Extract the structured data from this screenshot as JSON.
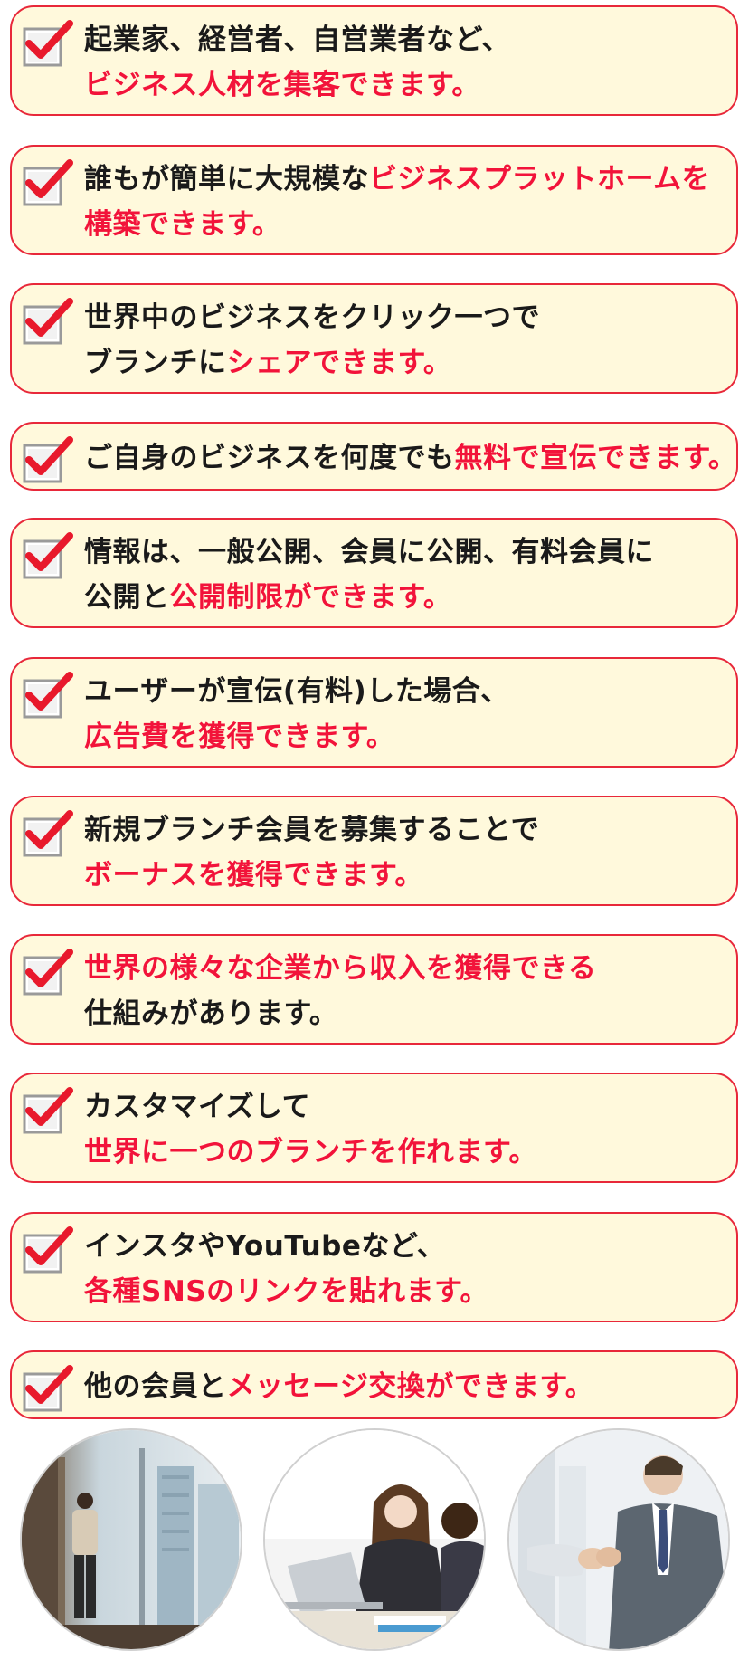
{
  "items": [
    {
      "line1": [
        {
          "t": "起業家、経営者、自営業者など、",
          "r": false
        }
      ],
      "line2": [
        {
          "t": "ビジネス人材を集客できます。",
          "r": true
        }
      ]
    },
    {
      "line1": [
        {
          "t": "誰もが簡単に大規模な",
          "r": false
        },
        {
          "t": "ビジネスプラットホームを",
          "r": true
        }
      ],
      "line2": [
        {
          "t": "構築できます。",
          "r": true
        }
      ]
    },
    {
      "line1": [
        {
          "t": "世界中のビジネスをクリック一つで",
          "r": false
        }
      ],
      "line2": [
        {
          "t": "ブランチに",
          "r": false
        },
        {
          "t": "シェアできます。",
          "r": true
        }
      ]
    },
    {
      "line1": [
        {
          "t": "ご自身のビジネスを何度でも",
          "r": false
        },
        {
          "t": "無料で宣伝できます。",
          "r": true
        }
      ]
    },
    {
      "line1": [
        {
          "t": "情報は、一般公開、会員に公開、有料会員に",
          "r": false
        }
      ],
      "line2": [
        {
          "t": "公開と",
          "r": false
        },
        {
          "t": "公開制限ができます。",
          "r": true
        }
      ]
    },
    {
      "line1": [
        {
          "t": "ユーザーが宣伝(有料)した場合、",
          "r": false
        }
      ],
      "line2": [
        {
          "t": "広告費を獲得できます。",
          "r": true
        }
      ]
    },
    {
      "line1": [
        {
          "t": "新規ブランチ会員を募集することで",
          "r": false
        }
      ],
      "line2": [
        {
          "t": "ボーナスを獲得できます。",
          "r": true
        }
      ]
    },
    {
      "line1": [
        {
          "t": "世界の様々な企業から収入を獲得できる",
          "r": true
        }
      ],
      "line2": [
        {
          "t": "仕組みがあります。",
          "r": false
        }
      ]
    },
    {
      "line1": [
        {
          "t": "カスタマイズして",
          "r": false
        }
      ],
      "line2": [
        {
          "t": "世界に一つのブランチを作れます。",
          "r": true
        }
      ]
    },
    {
      "line1": [
        {
          "t": "インスタやYouTubeなど、",
          "r": false
        }
      ],
      "line2": [
        {
          "t": "各種SNSのリンクを貼れます。",
          "r": true
        }
      ]
    },
    {
      "line1": [
        {
          "t": "他の会員と",
          "r": false
        },
        {
          "t": "メッセージ交換ができます。",
          "r": true
        }
      ]
    }
  ],
  "photos": [
    {
      "icon": "man-window-photo"
    },
    {
      "icon": "women-laptop-photo"
    },
    {
      "icon": "handshake-photo"
    }
  ],
  "colors": {
    "accent": "#f2133a",
    "card_bg": "#fff9dc",
    "border": "#e8283a",
    "text": "#1a1a1a"
  }
}
